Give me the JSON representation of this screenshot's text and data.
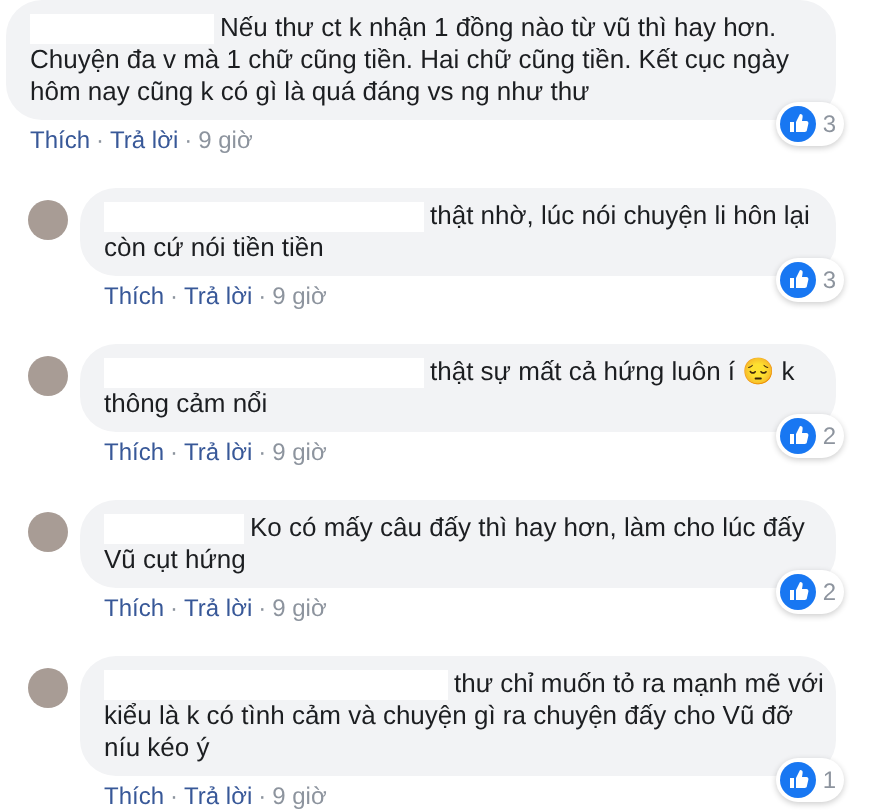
{
  "comments": [
    {
      "avatar": false,
      "lines": [
        "Nếu thư ct k nhận 1 đồng nào từ vũ thì hay hơn.",
        "Chuyện đa v mà 1 chữ cũng tiền. Hai chữ cũng tiền. Kết cục ngày",
        "hôm nay cũng k có gì là quá đáng vs ng như thư"
      ],
      "likes": "3",
      "actions": [
        "Thích",
        "Trả lời"
      ],
      "sep": "·",
      "time": "9 giờ"
    },
    {
      "avatar": true,
      "lines": [
        "thật nhờ, lúc nói chuyện li hôn lại",
        "còn cứ nói tiền tiền"
      ],
      "likes": "3",
      "actions": [
        "Thích",
        "Trả lời"
      ],
      "sep": "·",
      "time": "9 giờ"
    },
    {
      "avatar": true,
      "lines": [
        "thật sự mất cả hứng luôn í 😔 k",
        "thông cảm nổi"
      ],
      "likes": "2",
      "actions": [
        "Thích",
        "Trả lời"
      ],
      "sep": "·",
      "time": "9 giờ"
    },
    {
      "avatar": true,
      "lines": [
        "Ko có mấy câu đấy thì hay hơn, làm cho lúc đấy",
        "Vũ cụt hứng"
      ],
      "likes": "2",
      "actions": [
        "Thích",
        "Trả lời"
      ],
      "sep": "·",
      "time": "9 giờ"
    },
    {
      "avatar": true,
      "lines": [
        "thư chỉ muốn tỏ ra mạnh mẽ với",
        "kiểu là k có tình cảm và chuyện gì ra chuyện đấy cho Vũ đỡ",
        "níu kéo ý"
      ],
      "likes": "1",
      "actions": [
        "Thích",
        "Trả lời"
      ],
      "sep": "·",
      "time": "9 giờ"
    }
  ]
}
